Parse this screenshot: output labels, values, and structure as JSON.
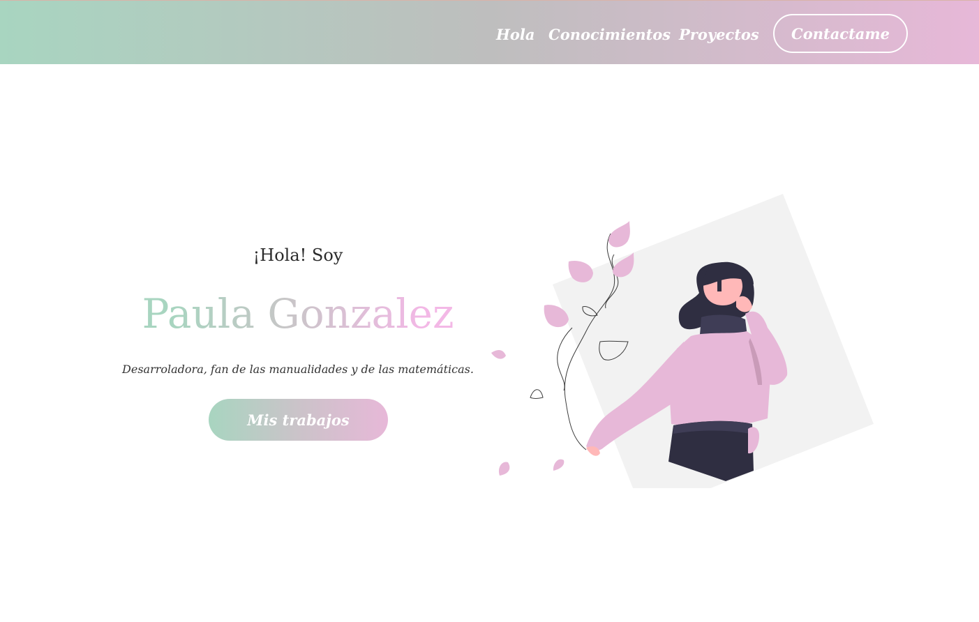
{
  "nav": {
    "items": [
      "Hola",
      "Conocimientos",
      "Proyectos"
    ],
    "contact_label": "Contactame"
  },
  "hero": {
    "greeting": "¡Hola! Soy",
    "name": "Paula Gonzalez",
    "tagline": "Desarroladora, fan de las manualidades y de las matemáticas.",
    "cta_label": "Mis trabajos"
  },
  "colors": {
    "mint": "#a8d5c0",
    "gray": "#bebebe",
    "pink": "#e7b8d8",
    "dark": "#2f2e41",
    "skin": "#ffb8b8"
  },
  "icons": {
    "illustration": "woman-with-leaves-illustration"
  }
}
